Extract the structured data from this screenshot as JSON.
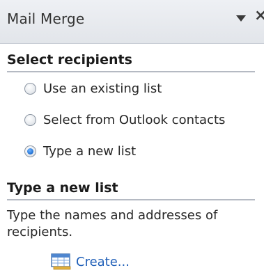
{
  "pane": {
    "title": "Mail Merge",
    "menu_icon": "dropdown-triangle-icon",
    "close_icon": "close-icon"
  },
  "select_recipients": {
    "heading": "Select recipients",
    "options": [
      {
        "label": "Use an existing list",
        "checked": false
      },
      {
        "label": "Select from Outlook contacts",
        "checked": false
      },
      {
        "label": "Type a new list",
        "checked": true
      }
    ]
  },
  "type_new_list": {
    "heading": "Type a new list",
    "description": "Type the names and addresses of recipients.",
    "create_label": "Create...",
    "create_icon": "table-list-icon"
  },
  "colors": {
    "accent": "#1f5fb8",
    "radio_selected": "#1f6fd1"
  }
}
